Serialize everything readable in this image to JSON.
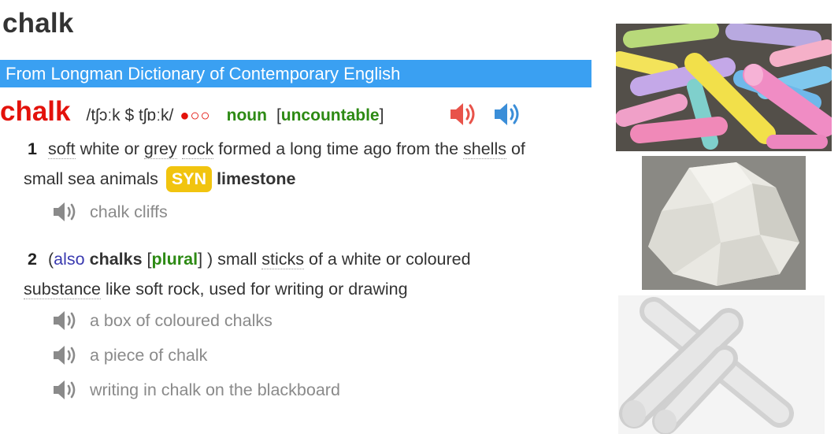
{
  "entry": {
    "title": "chalk",
    "source": "From Longman Dictionary of Contemporary English",
    "headword": "chalk",
    "pronunciation": "/tʃɔːk $ tʃɒːk/",
    "frequency": "●○○",
    "part_of_speech": "noun",
    "grammar_open": "[",
    "grammar": "uncountable",
    "grammar_close": "]"
  },
  "senses": [
    {
      "number": "1",
      "w1": "soft",
      "t1": " white or ",
      "w2": "grey",
      "t2": " ",
      "w3": "rock",
      "t3": " formed a long time ago from the ",
      "w4": "shells",
      "t4": " of",
      "line2": "small sea animals",
      "syn_label": "SYN",
      "synonym": "limestone",
      "examples": [
        "chalk cliffs"
      ]
    },
    {
      "number": "2",
      "paren_open": "(",
      "also": "also",
      "also_word": "chalks",
      "plural_open": "[",
      "plural": "plural",
      "plural_close": "] )",
      "t1": " small ",
      "w1": "sticks",
      "t2": " of a white or coloured",
      "w2": "substance",
      "t3": " like soft rock, used for writing or drawing",
      "examples": [
        "a box of coloured chalks",
        "a piece of chalk",
        "writing in chalk on the blackboard"
      ]
    }
  ],
  "colors": {
    "headword": "#e3120b",
    "banner": "#3aa0f2",
    "grammar_green": "#2d8a14",
    "syn_badge": "#f1c40f",
    "speaker_british": "#e8534a",
    "speaker_american": "#3b8ed8",
    "speaker_example": "#8a8a8a"
  },
  "icons": {
    "british_audio": "speaker-icon",
    "american_audio": "speaker-icon",
    "example_audio": "speaker-icon"
  },
  "images": [
    "colored-chalk-sticks-photo",
    "chalk-rock-photo",
    "white-chalk-sticks-photo"
  ]
}
